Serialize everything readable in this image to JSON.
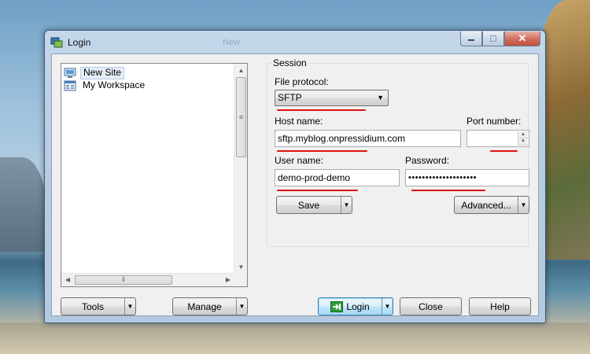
{
  "window": {
    "title": "Login",
    "ghost_title": "New"
  },
  "sites": [
    {
      "label": "New Site",
      "icon": "computer-icon",
      "selected": true
    },
    {
      "label": "My Workspace",
      "icon": "workspace-icon",
      "selected": false
    }
  ],
  "session": {
    "group_title": "Session",
    "file_protocol_label": "File protocol:",
    "file_protocol_value": "SFTP",
    "host_label": "Host name:",
    "host_value": "sftp.myblog.onpressidium.com",
    "port_label": "Port number:",
    "port_value": "",
    "user_label": "User name:",
    "user_value": "demo-prod-demo",
    "password_label": "Password:",
    "password_value": "••••••••••••••••••••",
    "save_label": "Save",
    "advanced_label": "Advanced..."
  },
  "buttons": {
    "tools": "Tools",
    "manage": "Manage",
    "login": "Login",
    "close": "Close",
    "help": "Help"
  },
  "colors": {
    "annotation": "#e01010",
    "accent": "#3c7fb1"
  }
}
